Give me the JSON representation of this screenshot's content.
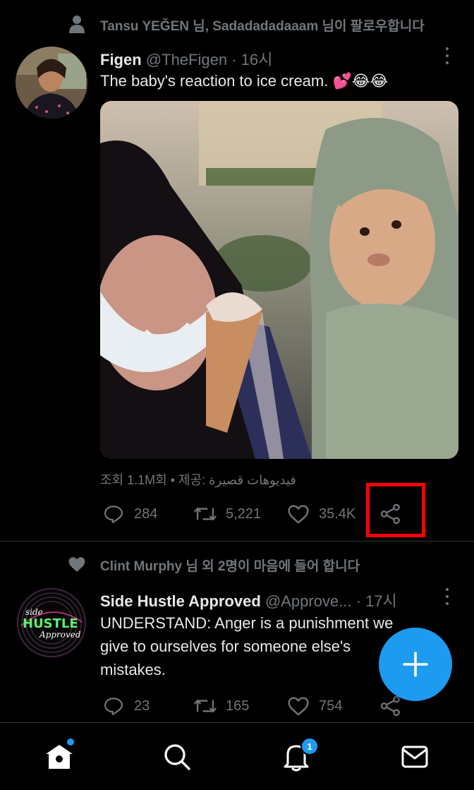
{
  "colors": {
    "accent": "#1d9bf0",
    "text_primary": "#e7e9ea",
    "text_secondary": "#71767b",
    "highlight_box": "#ff0000",
    "background": "#000000"
  },
  "tweet1": {
    "context": "Tansu YEĞEN 님, Sadadadadaaam 님이 팔로우합니다",
    "context_icon": "person-icon",
    "author_name": "Figen",
    "author_meta": "@TheFigen · 16시",
    "text": "The baby's reaction to ice cream. 💕😂😂",
    "views": "조회 1.1M회 • 제공: فيديوهات قصيرة",
    "reply_count": "284",
    "retweet_count": "5,221",
    "like_count": "35.4K"
  },
  "tweet2": {
    "context": "Clint Murphy 님 외 2명이 마음에 들어 합니다",
    "context_icon": "heart-icon",
    "author_name": "Side Hustle Approved",
    "author_meta": "@Approve...  · 17시",
    "avatar_logo": {
      "line1": "side",
      "line2": "HUSTLE",
      "line3": "Approved"
    },
    "text_lines": [
      "UNDERSTAND: Anger is a punishment we",
      "give to ourselves for someone else's",
      "mistakes."
    ],
    "reply_count": "23",
    "retweet_count": "165",
    "like_count": "754"
  },
  "compose_button": {
    "icon": "plus-icon"
  },
  "bottom_nav": {
    "items": [
      "home-icon",
      "search-icon",
      "notifications-icon",
      "messages-icon"
    ],
    "notification_badge": "1"
  }
}
